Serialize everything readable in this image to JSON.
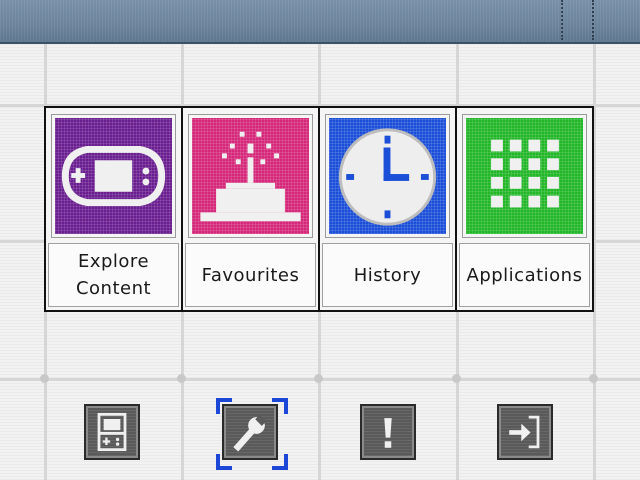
{
  "menu": {
    "tiles": [
      {
        "label": "Explore\nContent",
        "icon": "gamepad-icon",
        "color": "#6a1e90"
      },
      {
        "label": "Favourites",
        "icon": "cake-icon",
        "color": "#d5287a"
      },
      {
        "label": "History",
        "icon": "clock-icon",
        "color": "#1c4fd8"
      },
      {
        "label": "Applications",
        "icon": "grid-icon",
        "color": "#22b628"
      }
    ]
  },
  "toolbar": {
    "items": [
      {
        "icon": "handheld-console-icon"
      },
      {
        "icon": "wrench-icon",
        "selected": true
      },
      {
        "icon": "exclamation-icon"
      },
      {
        "icon": "exit-icon"
      }
    ],
    "selection_color": "#1b46d6"
  }
}
